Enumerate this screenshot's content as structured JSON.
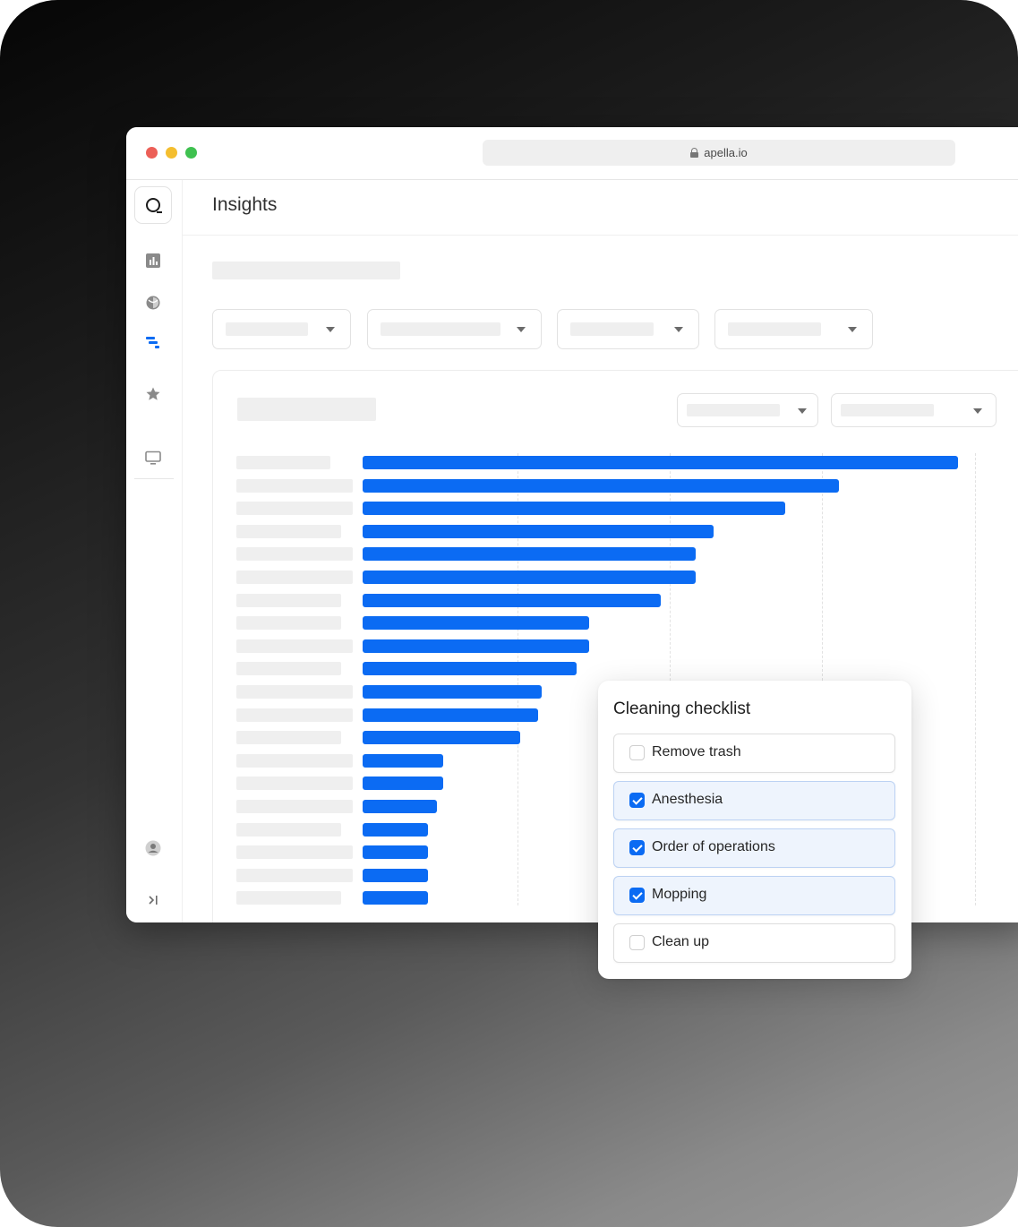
{
  "browser": {
    "url": "apella.io"
  },
  "sidebar": {
    "items": [
      {
        "icon": "logo-icon"
      },
      {
        "icon": "bar-chart-icon"
      },
      {
        "icon": "shield-icon"
      },
      {
        "icon": "insights-icon",
        "active": true
      },
      {
        "icon": "star-icon"
      },
      {
        "icon": "monitor-icon"
      },
      {
        "icon": "user-icon"
      },
      {
        "icon": "collapse-sidebar-icon"
      }
    ]
  },
  "page": {
    "title": "Insights"
  },
  "colors": {
    "accent": "#0b6bf3",
    "placeholder": "#efefef",
    "checked_bg": "#eef4fd"
  },
  "chart_data": {
    "type": "bar",
    "orientation": "horizontal",
    "categories": [],
    "values": [
      100,
      80,
      71,
      59,
      56,
      56,
      50,
      38,
      38,
      36,
      30,
      29.5,
      26.5,
      13.5,
      13.5,
      12.5,
      11,
      11,
      11,
      11
    ],
    "grid": true
  },
  "checklist": {
    "title": "Cleaning checklist",
    "items": [
      {
        "label": "Remove trash",
        "checked": false
      },
      {
        "label": "Anesthesia",
        "checked": true
      },
      {
        "label": "Order of operations",
        "checked": true
      },
      {
        "label": "Mopping",
        "checked": true
      },
      {
        "label": "Clean up",
        "checked": false
      }
    ]
  }
}
